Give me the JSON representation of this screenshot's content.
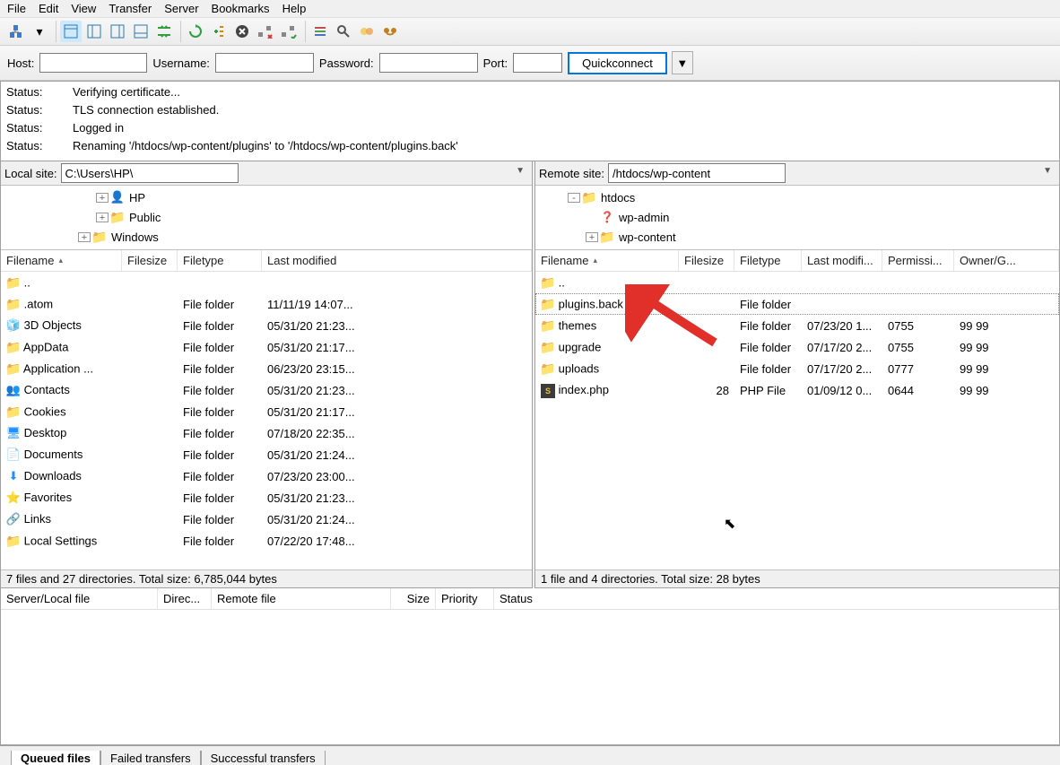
{
  "menu": [
    "File",
    "Edit",
    "View",
    "Transfer",
    "Server",
    "Bookmarks",
    "Help"
  ],
  "conn": {
    "host_label": "Host:",
    "user_label": "Username:",
    "pass_label": "Password:",
    "port_label": "Port:",
    "host": "",
    "user": "",
    "pass": "",
    "port": "",
    "quickconnect": "Quickconnect"
  },
  "log": [
    {
      "label": "Status:",
      "text": "Verifying certificate..."
    },
    {
      "label": "Status:",
      "text": "TLS connection established."
    },
    {
      "label": "Status:",
      "text": "Logged in"
    },
    {
      "label": "Status:",
      "text": "Renaming '/htdocs/wp-content/plugins' to '/htdocs/wp-content/plugins.back'"
    }
  ],
  "local": {
    "label": "Local site:",
    "path": "C:\\Users\\HP\\",
    "tree": [
      {
        "indent": 100,
        "expand": "+",
        "icon": "user",
        "name": "HP"
      },
      {
        "indent": 100,
        "expand": "+",
        "icon": "folder",
        "name": "Public"
      },
      {
        "indent": 80,
        "expand": "+",
        "icon": "folder",
        "name": "Windows"
      }
    ],
    "cols": [
      "Filename",
      "Filesize",
      "Filetype",
      "Last modified"
    ],
    "rows": [
      {
        "icon": "folder",
        "name": "..",
        "size": "",
        "type": "",
        "mod": ""
      },
      {
        "icon": "folder",
        "name": ".atom",
        "size": "",
        "type": "File folder",
        "mod": "11/11/19 14:07..."
      },
      {
        "icon": "cube",
        "name": "3D Objects",
        "size": "",
        "type": "File folder",
        "mod": "05/31/20 21:23..."
      },
      {
        "icon": "folder",
        "name": "AppData",
        "size": "",
        "type": "File folder",
        "mod": "05/31/20 21:17..."
      },
      {
        "icon": "folder",
        "name": "Application ...",
        "size": "",
        "type": "File folder",
        "mod": "06/23/20 23:15..."
      },
      {
        "icon": "cont",
        "name": "Contacts",
        "size": "",
        "type": "File folder",
        "mod": "05/31/20 21:23..."
      },
      {
        "icon": "folder",
        "name": "Cookies",
        "size": "",
        "type": "File folder",
        "mod": "05/31/20 21:17..."
      },
      {
        "icon": "desk",
        "name": "Desktop",
        "size": "",
        "type": "File folder",
        "mod": "07/18/20 22:35..."
      },
      {
        "icon": "doc",
        "name": "Documents",
        "size": "",
        "type": "File folder",
        "mod": "05/31/20 21:24..."
      },
      {
        "icon": "dl",
        "name": "Downloads",
        "size": "",
        "type": "File folder",
        "mod": "07/23/20 23:00..."
      },
      {
        "icon": "fav",
        "name": "Favorites",
        "size": "",
        "type": "File folder",
        "mod": "05/31/20 21:23..."
      },
      {
        "icon": "link",
        "name": "Links",
        "size": "",
        "type": "File folder",
        "mod": "05/31/20 21:24..."
      },
      {
        "icon": "folder",
        "name": "Local Settings",
        "size": "",
        "type": "File folder",
        "mod": "07/22/20 17:48..."
      }
    ],
    "status": "7 files and 27 directories. Total size: 6,785,044 bytes"
  },
  "remote": {
    "label": "Remote site:",
    "path": "/htdocs/wp-content",
    "tree": [
      {
        "indent": 30,
        "expand": "-",
        "icon": "folder",
        "name": "htdocs"
      },
      {
        "indent": 50,
        "expand": " ",
        "icon": "q",
        "name": "wp-admin"
      },
      {
        "indent": 50,
        "expand": "+",
        "icon": "folder",
        "name": "wp-content"
      }
    ],
    "cols": [
      "Filename",
      "Filesize",
      "Filetype",
      "Last modifi...",
      "Permissi...",
      "Owner/G..."
    ],
    "rows": [
      {
        "icon": "folder",
        "name": "..",
        "size": "",
        "type": "",
        "mod": "",
        "perm": "",
        "own": "",
        "selected": false
      },
      {
        "icon": "folder",
        "name": "plugins.back",
        "size": "",
        "type": "File folder",
        "mod": "",
        "perm": "",
        "own": "",
        "selected": true
      },
      {
        "icon": "folder",
        "name": "themes",
        "size": "",
        "type": "File folder",
        "mod": "07/23/20 1...",
        "perm": "0755",
        "own": "99 99"
      },
      {
        "icon": "folder",
        "name": "upgrade",
        "size": "",
        "type": "File folder",
        "mod": "07/17/20 2...",
        "perm": "0755",
        "own": "99 99"
      },
      {
        "icon": "folder",
        "name": "uploads",
        "size": "",
        "type": "File folder",
        "mod": "07/17/20 2...",
        "perm": "0777",
        "own": "99 99"
      },
      {
        "icon": "php",
        "name": "index.php",
        "size": "28",
        "type": "PHP File",
        "mod": "01/09/12 0...",
        "perm": "0644",
        "own": "99 99"
      }
    ],
    "status": "1 file and 4 directories. Total size: 28 bytes"
  },
  "queue": {
    "cols": [
      "Server/Local file",
      "Direc...",
      "Remote file",
      "Size",
      "Priority",
      "Status"
    ]
  },
  "tabs": [
    "Queued files",
    "Failed transfers",
    "Successful transfers"
  ]
}
